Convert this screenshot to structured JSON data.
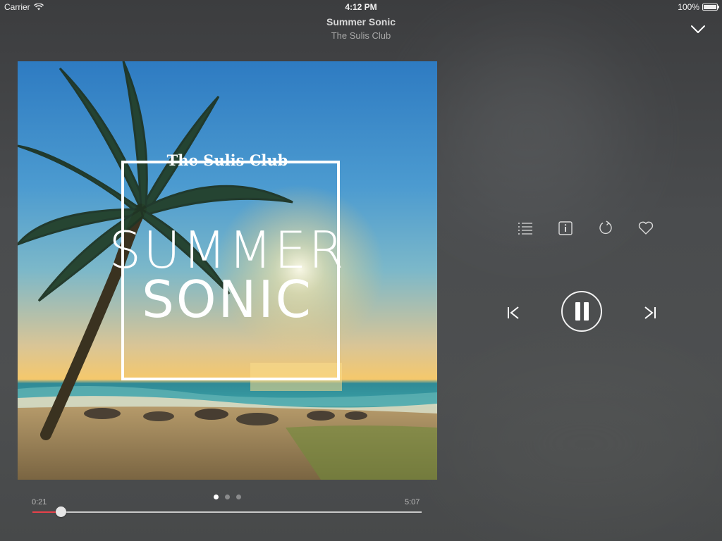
{
  "status_bar": {
    "carrier": "Carrier",
    "time": "4:12 PM",
    "battery": "100%"
  },
  "now_playing": {
    "title": "Summer Sonic",
    "artist": "The Sulis Club"
  },
  "album_art": {
    "club_text": "The Sulis Club",
    "title_line1": "SUMMER",
    "title_line2": "SONIC"
  },
  "pager": {
    "count": 3,
    "active_index": 0
  },
  "progress": {
    "elapsed": "0:21",
    "total": "5:07",
    "fraction": 0.075
  },
  "controls": {
    "actions": [
      "list-icon",
      "info-icon",
      "repeat-icon",
      "heart-icon"
    ],
    "transport": [
      "previous-icon",
      "pause-icon",
      "next-icon"
    ]
  },
  "colors": {
    "accent": "#e8414a",
    "background": "#4a4b4d"
  }
}
